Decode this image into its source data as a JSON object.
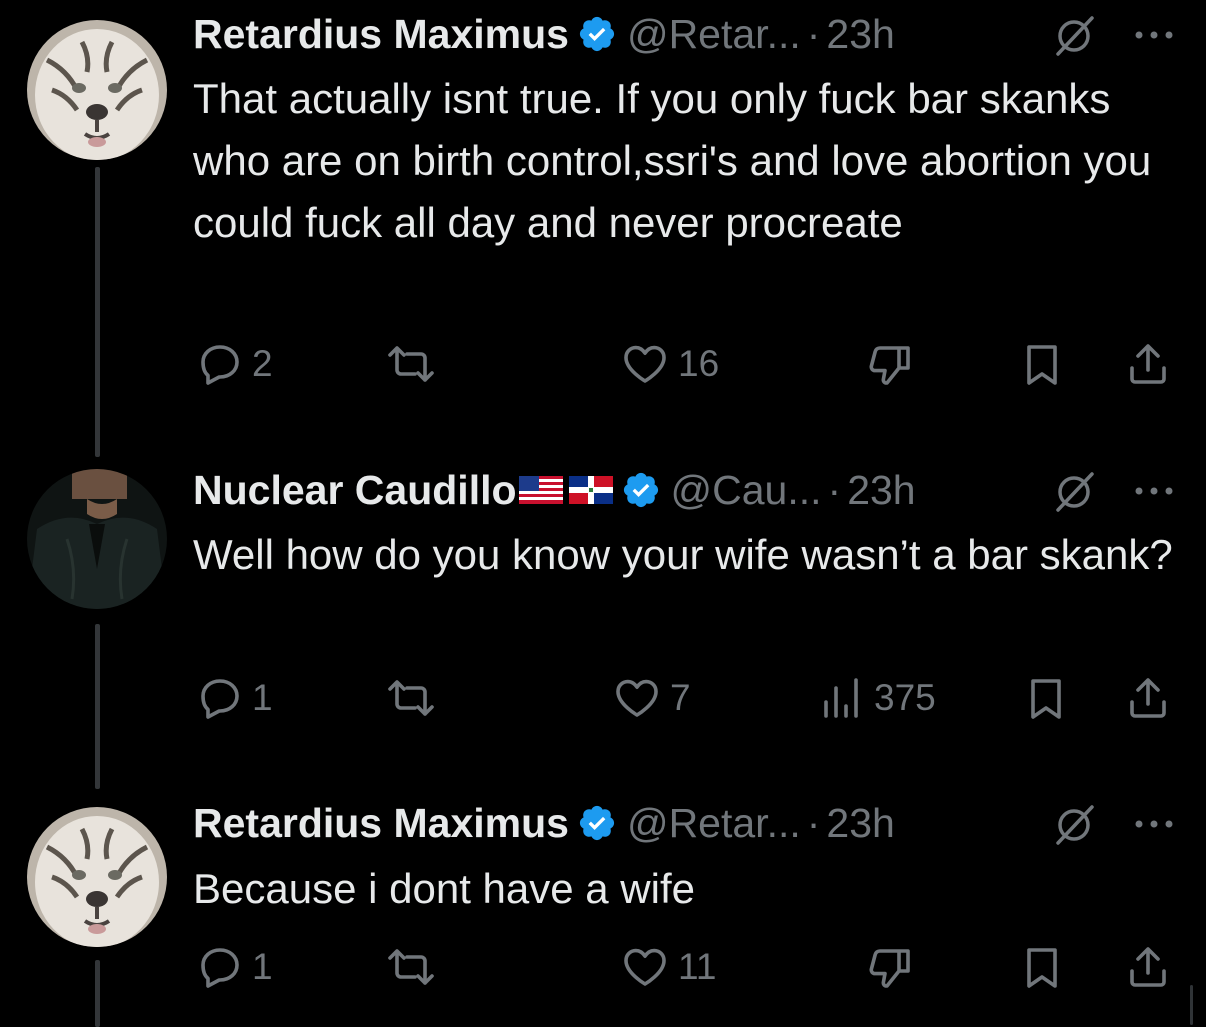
{
  "tweets": [
    {
      "name": "Retardius Maximus",
      "handle": "@Retar...",
      "separator": "·",
      "time": "23h",
      "text": "That actually isnt true. If you only fuck bar skanks who are on birth control,ssri's and love abortion you could fuck all day and never procreate",
      "replies": "2",
      "reposts": "",
      "likes": "16",
      "avatar_icon": "white-tiger-avatar",
      "fourth_action_icon": "dislike-icon"
    },
    {
      "name": "Nuclear Caudillo",
      "flags": [
        "us-flag-icon",
        "dominican-republic-flag-icon"
      ],
      "handle": "@Cau...",
      "separator": "·",
      "time": "23h",
      "text": "Well how do you know your wife wasn’t a bar skank?",
      "replies": "1",
      "reposts": "",
      "likes": "7",
      "views": "375",
      "avatar_icon": "man-in-dark-suit-avatar",
      "fourth_action_icon": "views-icon"
    },
    {
      "name": "Retardius Maximus",
      "handle": "@Retar...",
      "separator": "·",
      "time": "23h",
      "text": "Because i dont have a wife",
      "replies": "1",
      "reposts": "",
      "likes": "11",
      "avatar_icon": "white-tiger-avatar",
      "fourth_action_icon": "dislike-icon"
    }
  ],
  "colors": {
    "background": "#000000",
    "text_primary": "#e7e9ea",
    "text_secondary": "#71767b",
    "verified_blue": "#1d9bf0",
    "thread_line": "#333639"
  }
}
